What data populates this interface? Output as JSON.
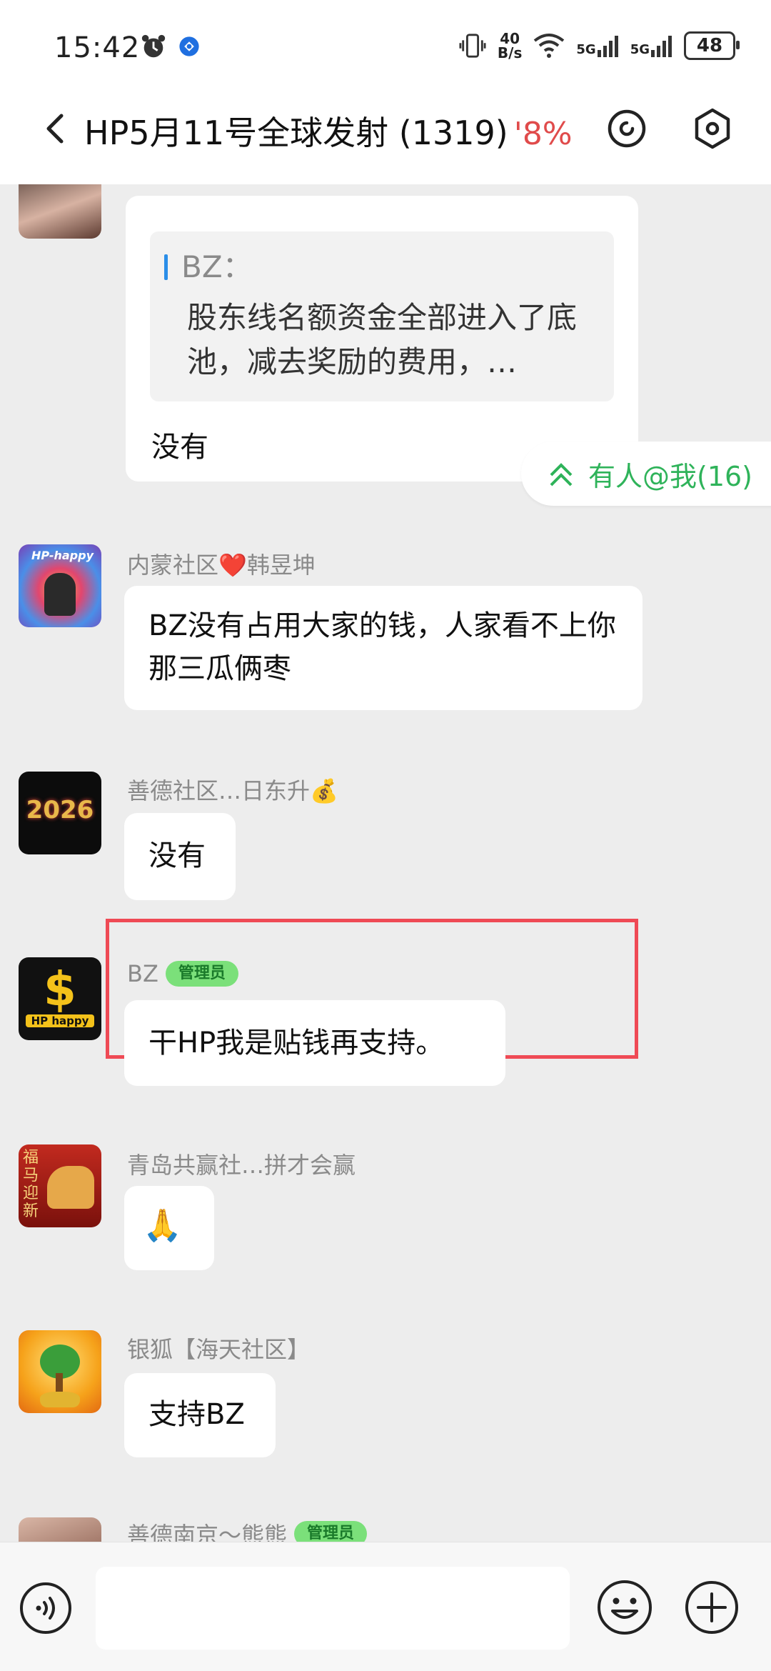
{
  "status_bar": {
    "time": "15:42",
    "net_speed_top": "40",
    "net_speed_bottom": "B/s",
    "sig1": "5G",
    "sig2": "5G",
    "battery": "48"
  },
  "header": {
    "title": "HP5月11号全球发射 (1319)",
    "percent": "'8%"
  },
  "messages": [
    {
      "quote_name": "BZ：",
      "quote_text": "股东线名额资金全部进入了底池，减去奖励的费用，…",
      "text": "没有"
    },
    {
      "sender": "内蒙社区❤️韩昱坤",
      "text": "BZ没有占用大家的钱，人家看不上你那三瓜俩枣"
    },
    {
      "sender": "善德社区…日东升💰",
      "text": "没有",
      "avatar_text": "2026"
    },
    {
      "sender": "BZ",
      "badge": "管理员",
      "text": "干HP我是贴钱再支持。",
      "avatar_text": "HP happy"
    },
    {
      "sender": "青岛共赢社…拼才会赢",
      "text": "🙏",
      "avatar_text": "福马迎新"
    },
    {
      "sender": "银狐【海天社区】",
      "text": "支持BZ"
    },
    {
      "sender": "善德南京～熊熊",
      "badge": "管理员"
    }
  ],
  "mention": {
    "label": "有人@我(16)"
  },
  "input": {
    "placeholder": ""
  },
  "colors": {
    "accent_green": "#2fb35a",
    "highlight_red": "#ef4a55",
    "admin_badge": "#7be07a"
  }
}
